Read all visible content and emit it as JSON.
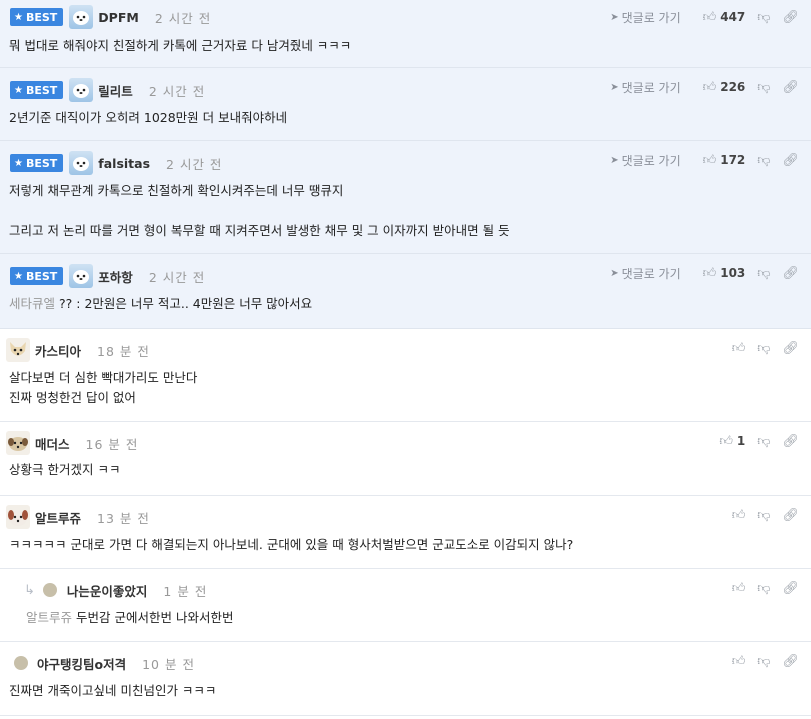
{
  "labels": {
    "best": "BEST",
    "reply_link": "댓글로 가기"
  },
  "comments": [
    {
      "nick": "DPFM",
      "time": "2 시간 전",
      "likes": "447",
      "lines": [
        "뭐 법대로 해줘야지 친절하게 카톡에 근거자료 다 남겨줬네 ㅋㅋㅋ"
      ]
    },
    {
      "nick": "릴리트",
      "time": "2 시간 전",
      "likes": "226",
      "lines": [
        "2년기준 대직이가 오히려 1028만원 더 보내줘야하네"
      ]
    },
    {
      "nick": "falsitas",
      "time": "2 시간 전",
      "likes": "172",
      "lines": [
        "저렇게 채무관계 카톡으로 친절하게 확인시켜주는데 너무 땡큐지",
        "",
        "그리고 저 논리 따를 거면 형이 복무할 때 지켜주면서 발생한 채무 및 그 이자까지 받아내면 될 듯"
      ]
    },
    {
      "nick": "포하항",
      "time": "2 시간 전",
      "likes": "103",
      "mention": "세타큐엘",
      "lines": [
        "?? : 2만원은 너무 적고.. 4만원은 너무 많아서요"
      ]
    },
    {
      "nick": "카스티아",
      "time": "18 분 전",
      "likes": "",
      "lines": [
        "살다보면 더 심한 빡대가리도 만난다",
        "진짜 멍청한건 답이 없어"
      ]
    },
    {
      "nick": "매더스",
      "time": "16 분 전",
      "likes": "1",
      "lines": [
        "상황극 한거겠지 ㅋㅋ"
      ]
    },
    {
      "nick": "알트루쥬",
      "time": "13 분 전",
      "likes": "",
      "lines": [
        "ㅋㅋㅋㅋㅋ 군대로 가면 다 해결되는지 아나보네. 군대에 있을 때 형사처벌받으면 군교도소로 이감되지 않나?"
      ]
    },
    {
      "nick": "나는운이좋았지",
      "time": "1 분 전",
      "likes": "",
      "mention": "알트루쥬",
      "lines": [
        "두번감 군에서한번 나와서한번"
      ]
    },
    {
      "nick": "야구탱킹팀o저격",
      "time": "10 분 전",
      "likes": "",
      "lines": [
        "진짜면 개죽이고싶네 미친넘인가 ㅋㅋㅋ"
      ]
    }
  ]
}
